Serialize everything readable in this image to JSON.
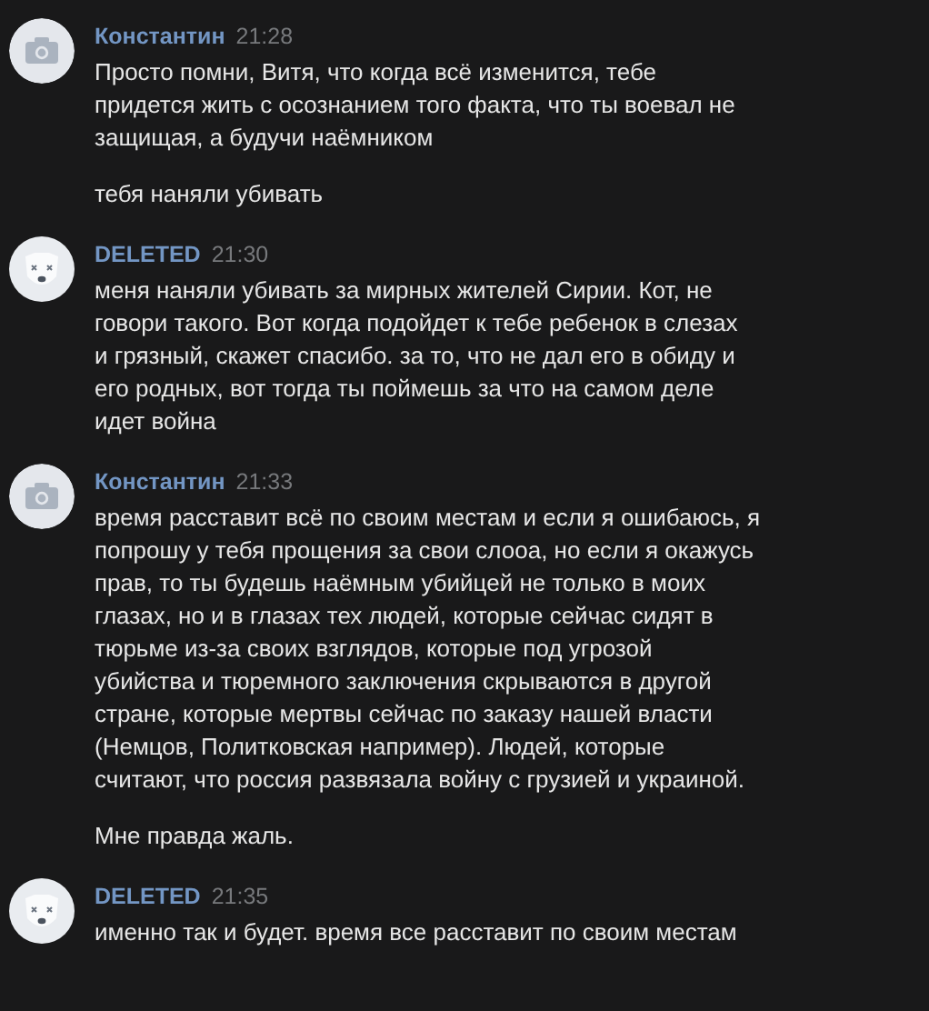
{
  "messages": [
    {
      "author": "Константин",
      "time": "21:28",
      "kind": "camera",
      "paragraphs": [
        "Просто помни, Витя, что когда всё изменится, тебе\nпридется жить с осознанием того факта, что ты воевал не\nзащищая, а будучи наёмником",
        "тебя наняли убивать"
      ]
    },
    {
      "author": "DELETED",
      "time": "21:30",
      "kind": "dog",
      "paragraphs": [
        "меня наняли убивать за мирных жителей Сирии. Кот, не\nговори такого. Вот когда подойдет к тебе ребенок в слезах\nи грязный, скажет спасибо. за то, что не дал его в обиду и\nего родных, вот тогда ты поймешь за что на самом деле\nидет война"
      ]
    },
    {
      "author": "Константин",
      "time": "21:33",
      "kind": "camera",
      "paragraphs": [
        "время расставит всё по своим местам и если я ошибаюсь, я\nпопрошу у тебя прощения за свои слооа, но если я окажусь\nправ, то ты будешь наёмным убийцей не только в моих\nглазах, но и в глазах тех людей, которые сейчас сидят в\nтюрьме из-за своих взглядов, которые под угрозой\nубийства и тюремного заключения скрываются в другой\nстране, которые мертвы сейчас по заказу нашей власти\n(Немцов, Политковская например). Людей, которые\nсчитают, что россия развязала войну с грузией и украиной.",
        "Мне правда жаль."
      ]
    },
    {
      "author": "DELETED",
      "time": "21:35",
      "kind": "dog",
      "paragraphs": [
        "именно так и будет. время все расставит по своим местам"
      ]
    }
  ]
}
